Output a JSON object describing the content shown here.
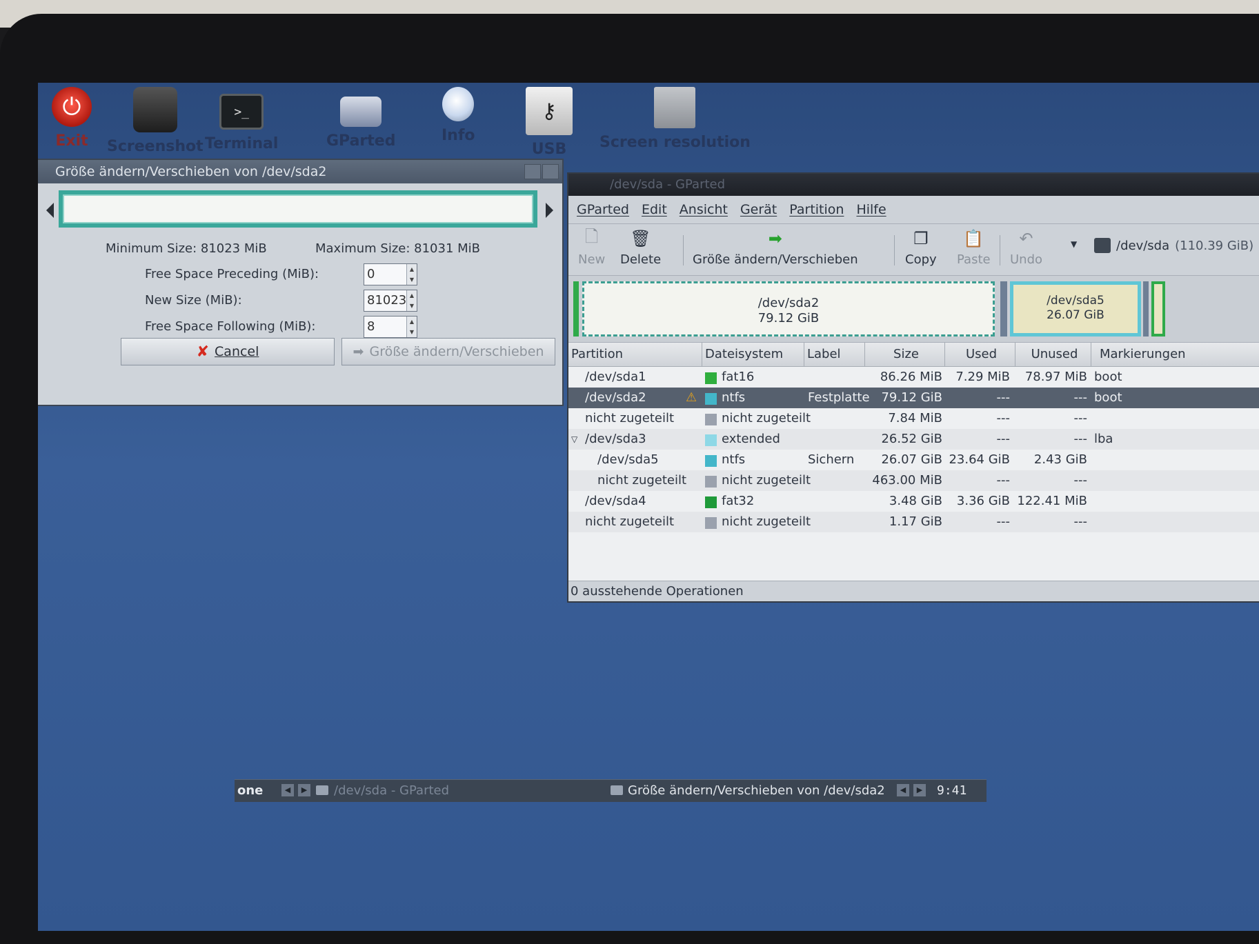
{
  "launcher": [
    {
      "label": "Exit",
      "icon": "power-icon",
      "glyph": "⏻"
    },
    {
      "label": "Screenshot",
      "icon": "camera-icon",
      "glyph": ""
    },
    {
      "label": "Terminal",
      "icon": "terminal-icon",
      "glyph": ">_"
    },
    {
      "label": "GParted",
      "icon": "gparted-icon",
      "glyph": ""
    },
    {
      "label": "Info",
      "icon": "lightbulb-icon",
      "glyph": ""
    },
    {
      "label": "USB",
      "icon": "usb-drive-icon",
      "glyph": "⚷"
    },
    {
      "label": "Screen resolution",
      "icon": "monitor-icon",
      "glyph": ""
    }
  ],
  "dialog": {
    "title": "Größe ändern/Verschieben von /dev/sda2",
    "min_size": "Minimum Size: 81023 MiB",
    "max_size": "Maximum Size: 81031 MiB",
    "fields": {
      "preceding_label": "Free Space Preceding (MiB):",
      "preceding_value": "0",
      "newsize_label": "New Size (MiB):",
      "newsize_value": "81023",
      "following_label": "Free Space Following (MiB):",
      "following_value": "8"
    },
    "cancel_label": "Cancel",
    "apply_label": "Größe ändern/Verschieben"
  },
  "gparted": {
    "title": "/dev/sda - GParted",
    "menu": [
      "GParted",
      "Edit",
      "Ansicht",
      "Gerät",
      "Partition",
      "Hilfe"
    ],
    "toolbar": {
      "new": "New",
      "delete": "Delete",
      "resize": "Größe ändern/Verschieben",
      "copy": "Copy",
      "paste": "Paste",
      "undo": "Undo"
    },
    "device": "/dev/sda",
    "device_size": "(110.39 GiB)",
    "diskmap": {
      "sda2_name": "/dev/sda2",
      "sda2_size": "79.12 GiB",
      "sda5_name": "/dev/sda5",
      "sda5_size": "26.07 GiB"
    },
    "columns": [
      "Partition",
      "Dateisystem",
      "Label",
      "Size",
      "Used",
      "Unused",
      "Markierungen"
    ],
    "rows": [
      {
        "partition": "/dev/sda1",
        "fs": "fat16",
        "fs_color": "#2fae3e",
        "label": "",
        "size": "86.26 MiB",
        "used": "7.29 MiB",
        "unused": "78.97 MiB",
        "flags": "boot"
      },
      {
        "partition": "/dev/sda2",
        "fs": "ntfs",
        "fs_color": "#43b6c9",
        "label": "Festplatte",
        "size": "79.12 GiB",
        "used": "---",
        "unused": "---",
        "flags": "boot"
      },
      {
        "partition": "nicht zugeteilt",
        "fs": "nicht zugeteilt",
        "fs_color": "#9aa1ad",
        "label": "",
        "size": "7.84 MiB",
        "used": "---",
        "unused": "---",
        "flags": ""
      },
      {
        "partition": "/dev/sda3",
        "fs": "extended",
        "fs_color": "#8ed8e6",
        "label": "",
        "size": "26.52 GiB",
        "used": "---",
        "unused": "---",
        "flags": "lba"
      },
      {
        "partition": "/dev/sda5",
        "fs": "ntfs",
        "fs_color": "#43b6c9",
        "label": "Sichern",
        "size": "26.07 GiB",
        "used": "23.64 GiB",
        "unused": "2.43 GiB",
        "flags": ""
      },
      {
        "partition": "nicht zugeteilt",
        "fs": "nicht zugeteilt",
        "fs_color": "#9aa1ad",
        "label": "",
        "size": "463.00 MiB",
        "used": "---",
        "unused": "---",
        "flags": ""
      },
      {
        "partition": "/dev/sda4",
        "fs": "fat32",
        "fs_color": "#1f9a3a",
        "label": "",
        "size": "3.48 GiB",
        "used": "3.36 GiB",
        "unused": "122.41 MiB",
        "flags": ""
      },
      {
        "partition": "nicht zugeteilt",
        "fs": "nicht zugeteilt",
        "fs_color": "#9aa1ad",
        "label": "",
        "size": "1.17 GiB",
        "used": "---",
        "unused": "---",
        "flags": ""
      }
    ],
    "status": "0 ausstehende Operationen"
  },
  "taskbar": {
    "workspace": "one",
    "task1": "/dev/sda - GParted",
    "task2": "Größe ändern/Verschieben von /dev/sda2",
    "clock": "9:41"
  }
}
